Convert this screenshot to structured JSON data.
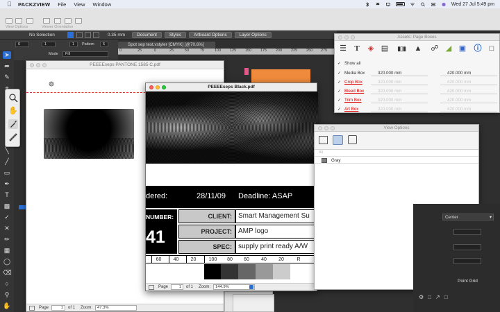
{
  "menubar": {
    "app_name": "PACKZVIEW",
    "items": [
      "File",
      "View",
      "Window"
    ],
    "datetime": "Wed 27 Jul  5:49 pm"
  },
  "toolstrip": {
    "label1": "View Options",
    "label2": "Viewer Orientation"
  },
  "controlbar": {
    "selection": "No Selection",
    "stroke_value": "0.35 mm",
    "buttons": [
      "Document",
      "Styles",
      "Artboard Options",
      "Layer Options"
    ],
    "field_a": "6",
    "field_b": "1",
    "field_c": "1",
    "field_d": "6",
    "pattern_label": "Pattern",
    "mode_label": "Mode",
    "mode_value": "Fill"
  },
  "document_tab": {
    "title": "Spot sep test.vstyler [CMYK] [@70.6%]"
  },
  "ruler": {
    "ticks": [
      "0",
      "25",
      "0",
      "25",
      "50",
      "75",
      "100",
      "125",
      "150",
      "175",
      "200",
      "225",
      "250",
      "275",
      "300"
    ]
  },
  "window_pantone": {
    "title": "PEEEEseps PANTONE 1585 C.pdf",
    "page_label": "Page",
    "page_value": "1",
    "of_label": "of 1",
    "zoom_label": "Zoom:",
    "zoom_value": "47.3%"
  },
  "window_black": {
    "title": "PEEEEseps Black.pdf",
    "ordered_text": "dered:",
    "date_text": "28/11/09",
    "deadline_text": "Deadline: ASAP",
    "number_label": "NUMBER:",
    "number_value": "41",
    "client_label": "CLIENT:",
    "client_value": "Smart Management Su",
    "project_label": "PROJECT:",
    "project_value": "AMP logo",
    "spec_label": "SPEC:",
    "spec_value": "supply print ready A/W",
    "scale_values": [
      "60",
      "40",
      "20",
      "100",
      "80",
      "60",
      "40",
      "20",
      "R"
    ],
    "page_label": "Page",
    "page_value": "1",
    "of_label": "of 1",
    "zoom_label": "Zoom:",
    "zoom_value": "144.9%"
  },
  "asset_panel": {
    "title": "Assets: Page Boxes",
    "show_all": "Show all",
    "rows": [
      {
        "name": "Media Box",
        "width": "320.000 mm",
        "height": "420.000 mm",
        "active": true
      },
      {
        "name": "Crop Box",
        "width": "320.000 mm",
        "height": "420.000 mm",
        "active": false
      },
      {
        "name": "Bleed Box",
        "width": "320.000 mm",
        "height": "420.000 mm",
        "active": false
      },
      {
        "name": "Trim Box",
        "width": "320.000 mm",
        "height": "420.000 mm",
        "active": false
      },
      {
        "name": "Art Box",
        "width": "320.000 mm",
        "height": "420.000 mm",
        "active": false
      }
    ]
  },
  "view_options": {
    "title": "View Options",
    "all_label": "All",
    "items": [
      {
        "name": "Gray",
        "swatch": "#808080"
      }
    ]
  },
  "right_panel": {
    "dropdown": "Center",
    "field1": "",
    "field2": "",
    "field3": "",
    "grid_label": "Point Grid"
  },
  "colors": {
    "accent_orange": "#f08a3c",
    "accent_pink": "#e25a8c",
    "selected_blue": "#2a6fd6"
  }
}
